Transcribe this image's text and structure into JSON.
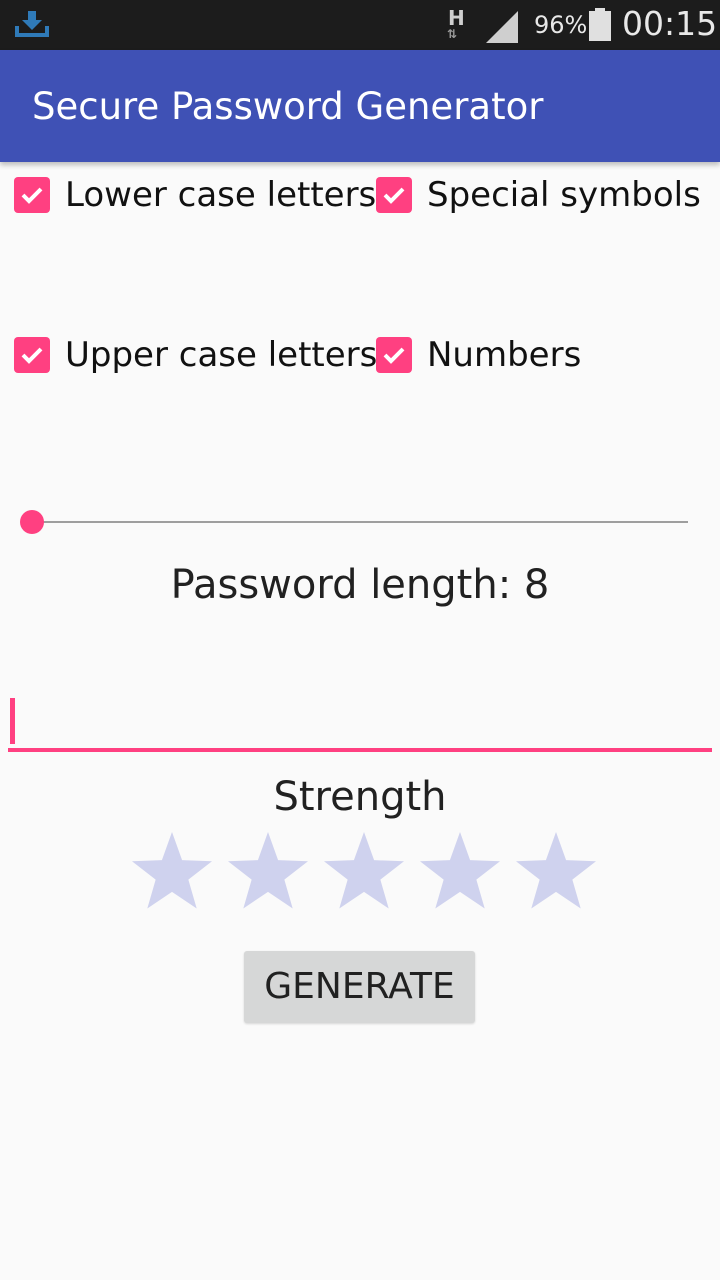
{
  "status_bar": {
    "network_letter": "H",
    "network_arrows": "⇅",
    "battery": "96%",
    "time": "00:15"
  },
  "app_bar": {
    "title": "Secure Password Generator"
  },
  "options": {
    "lower": {
      "label": "Lower case letters",
      "checked": true
    },
    "special": {
      "label": "Special symbols",
      "checked": true
    },
    "upper": {
      "label": "Upper case letters",
      "checked": true
    },
    "numbers": {
      "label": "Numbers",
      "checked": true
    }
  },
  "length": {
    "text": "Password length: 8",
    "slider_fraction": 0
  },
  "password": {
    "value": ""
  },
  "strength": {
    "label": "Strength",
    "rating": 0,
    "max": 5
  },
  "generate_label": "GENERATE",
  "colors": {
    "primary": "#3f51b5",
    "accent": "#ff4081",
    "star_empty": "#cfd2ee",
    "status_bar": "#1c1c1c"
  }
}
